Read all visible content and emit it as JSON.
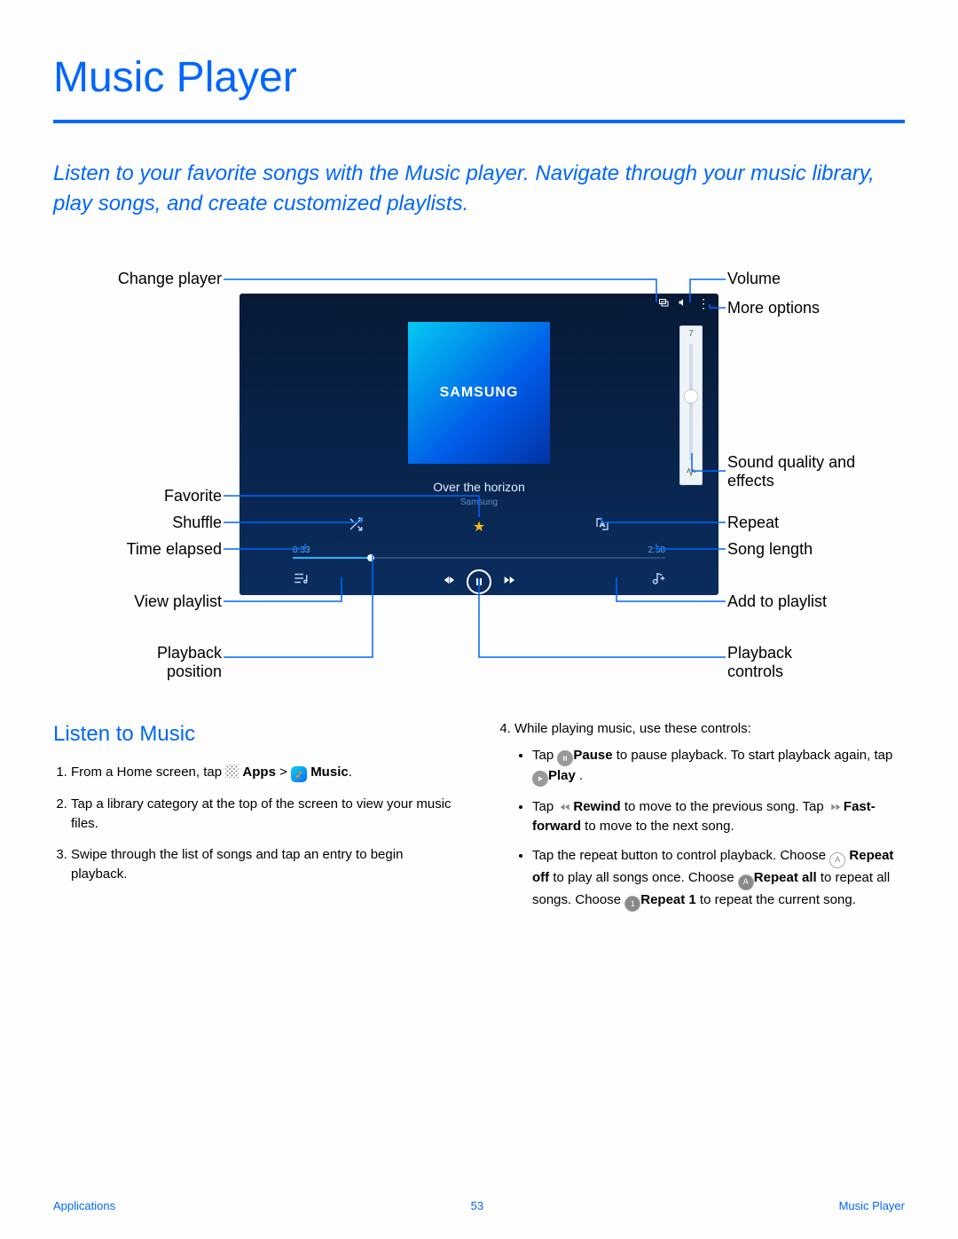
{
  "page_title": "Music Player",
  "intro": "Listen to your favorite songs with the Music player. Navigate through your music library, play songs, and create customized playlists.",
  "callouts": {
    "change_player": "Change player",
    "volume": "Volume",
    "more_options": "More options",
    "sound_quality": "Sound quality and effects",
    "favorite": "Favorite",
    "shuffle": "Shuffle",
    "repeat": "Repeat",
    "time_elapsed": "Time elapsed",
    "song_length": "Song length",
    "view_playlist": "View playlist",
    "add_to_playlist": "Add to playlist",
    "playback_position": "Playback position",
    "playback_controls": "Playback controls"
  },
  "player": {
    "brand": "SAMSUNG",
    "song_title": "Over the horizon",
    "song_artist": "Samsung",
    "time_elapsed": "0:33",
    "time_total": "2:58",
    "volume_level": "7"
  },
  "listen": {
    "heading": "Listen to Music",
    "step1_a": "From a Home screen, tap ",
    "step1_apps": "Apps",
    "step1_gt": " > ",
    "step1_music": "Music",
    "step1_end": ".",
    "step2": "Tap a library category at the top of the screen to view your music files.",
    "step3": "Swipe through the list of songs and tap an entry to begin playback.",
    "step4": "While playing music, use these controls:",
    "b1_a": "Tap ",
    "b1_pause": "Pause",
    "b1_b": " to pause playback. To start playback again, tap ",
    "b1_play": "Play",
    "b1_c": " .",
    "b2_a": "Tap ",
    "b2_rew": "Rewind",
    "b2_b": " to move to the previous song. Tap ",
    "b2_ff": "Fast-forward",
    "b2_c": " to move to the next song.",
    "b3_a": "Tap the repeat button to control playback. Choose ",
    "b3_off": "Repeat off",
    "b3_off2": " to play all songs once. Choose ",
    "b3_all": "Repeat all",
    "b3_all2": " to repeat all songs. Choose ",
    "b3_one": "Repeat 1",
    "b3_one2": " to repeat the current song."
  },
  "footer": {
    "left": "Applications",
    "center": "53",
    "right": "Music Player"
  }
}
